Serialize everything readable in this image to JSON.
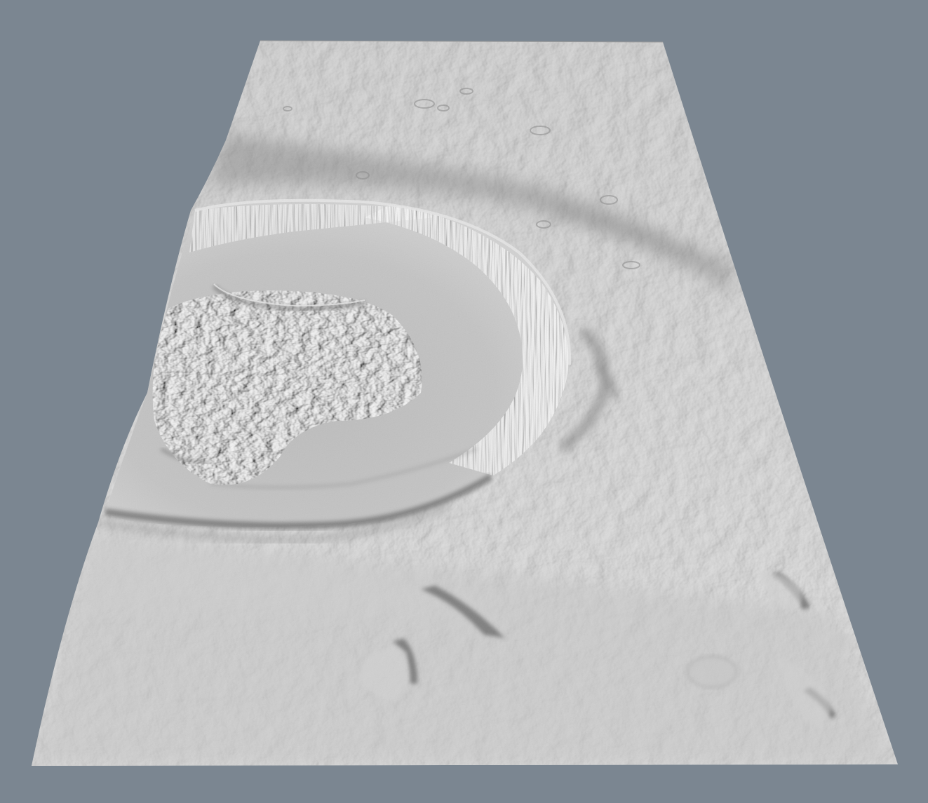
{
  "viewport": {
    "background_color": "#7b8691"
  },
  "terrain": {
    "surface_color": "#b9b9b9",
    "shadow_color": "#555555",
    "highlight_color": "#e2e2e2"
  }
}
